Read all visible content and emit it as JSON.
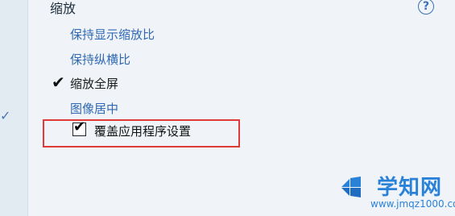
{
  "section": {
    "title": "缩放"
  },
  "options": [
    {
      "label": "保持显示缩放比",
      "selected": false
    },
    {
      "label": "保持纵横比",
      "selected": false
    },
    {
      "label": "缩放全屏",
      "selected": true
    },
    {
      "label": "图像居中",
      "selected": false
    }
  ],
  "override": {
    "label": "覆盖应用程序设置",
    "checked": true
  },
  "help_icon": "help-circle-icon",
  "watermark": {
    "title": "学知网",
    "url": "www.jmqz1000.com"
  },
  "colors": {
    "link": "#2f69b3",
    "highlight_border": "#e03a3a",
    "watermark": "#2a82d8"
  }
}
